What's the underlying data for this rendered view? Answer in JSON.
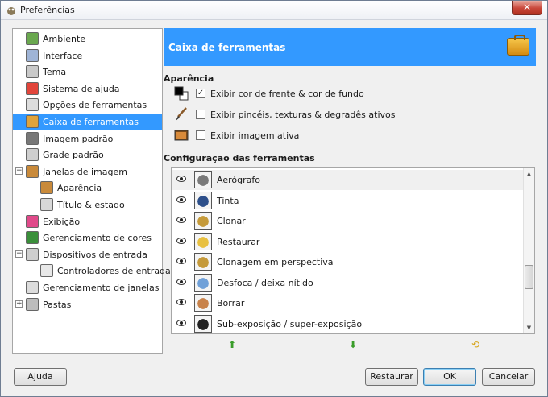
{
  "window": {
    "title": "Preferências",
    "close_glyph": "✕"
  },
  "sidebar": {
    "items": [
      {
        "label": "Ambiente",
        "icon": "environment-icon",
        "color": "#6aa84f",
        "level": 0,
        "expander": ""
      },
      {
        "label": "Interface",
        "icon": "interface-icon",
        "color": "#9fb4d6",
        "level": 0,
        "expander": ""
      },
      {
        "label": "Tema",
        "icon": "theme-icon",
        "color": "#c9c9c9",
        "level": 0,
        "expander": ""
      },
      {
        "label": "Sistema de ajuda",
        "icon": "lifebuoy-icon",
        "color": "#e2453b",
        "level": 0,
        "expander": ""
      },
      {
        "label": "Opções de ferramentas",
        "icon": "tool-options-icon",
        "color": "#dddddd",
        "level": 0,
        "expander": ""
      },
      {
        "label": "Caixa de ferramentas",
        "icon": "toolbox-icon",
        "color": "#e0a33a",
        "level": 0,
        "expander": "",
        "selected": true
      },
      {
        "label": "Imagem padrão",
        "icon": "default-image-icon",
        "color": "#777777",
        "level": 0,
        "expander": ""
      },
      {
        "label": "Grade padrão",
        "icon": "grid-icon",
        "color": "#cfcfcf",
        "level": 0,
        "expander": ""
      },
      {
        "label": "Janelas de imagem",
        "icon": "image-windows-icon",
        "color": "#c98a3a",
        "level": 0,
        "expander": "−"
      },
      {
        "label": "Aparência",
        "icon": "appearance-icon",
        "color": "#c98a3a",
        "level": 1,
        "expander": ""
      },
      {
        "label": "Título & estado",
        "icon": "title-status-icon",
        "color": "#d8d8d8",
        "level": 1,
        "expander": ""
      },
      {
        "label": "Exibição",
        "icon": "display-icon",
        "color": "#e04a8a",
        "level": 0,
        "expander": ""
      },
      {
        "label": "Gerenciamento de cores",
        "icon": "color-management-icon",
        "color": "#3a8f3a",
        "level": 0,
        "expander": ""
      },
      {
        "label": "Dispositivos de entrada",
        "icon": "input-devices-icon",
        "color": "#cfcfcf",
        "level": 0,
        "expander": "−"
      },
      {
        "label": "Controladores de entrada",
        "icon": "input-controllers-icon",
        "color": "#e8e8e8",
        "level": 1,
        "expander": ""
      },
      {
        "label": "Gerenciamento de janelas",
        "icon": "window-management-icon",
        "color": "#dcdcdc",
        "level": 0,
        "expander": ""
      },
      {
        "label": "Pastas",
        "icon": "folders-icon",
        "color": "#bdbdbd",
        "level": 0,
        "expander": "+"
      }
    ]
  },
  "banner": {
    "title": "Caixa de ferramentas",
    "icon": "toolbox-icon"
  },
  "appearance": {
    "heading": "Aparência",
    "options": [
      {
        "label": "Exibir cor de frente &  cor de fundo",
        "checked": true,
        "check_glyph": "✓",
        "icon": "fg-bg-color-icon"
      },
      {
        "label": "Exibir pincéis, texturas & degradês ativos",
        "checked": false,
        "check_glyph": "",
        "icon": "brush-icon"
      },
      {
        "label": "Exibir imagem ativa",
        "checked": false,
        "check_glyph": "",
        "icon": "active-image-icon"
      }
    ]
  },
  "tools": {
    "heading": "Configuração das ferramentas",
    "items": [
      {
        "label": "Aerógrafo",
        "icon": "airbrush-icon",
        "color": "#7a7a7a"
      },
      {
        "label": "Tinta",
        "icon": "ink-icon",
        "color": "#2d4f8a"
      },
      {
        "label": "Clonar",
        "icon": "clone-icon",
        "color": "#c59a3a"
      },
      {
        "label": "Restaurar",
        "icon": "heal-icon",
        "color": "#e8c040"
      },
      {
        "label": "Clonagem em perspectiva",
        "icon": "perspective-clone-icon",
        "color": "#c59a3a"
      },
      {
        "label": "Desfoca / deixa nítido",
        "icon": "blur-sharpen-icon",
        "color": "#6fa0d8"
      },
      {
        "label": "Borrar",
        "icon": "smudge-icon",
        "color": "#c8824a"
      },
      {
        "label": "Sub-exposição / super-exposição",
        "icon": "dodge-burn-icon",
        "color": "#222222"
      }
    ],
    "scroll_up_glyph": "▲",
    "scroll_down_glyph": "▼",
    "move_up_glyph": "⬆",
    "move_down_glyph": "⬇",
    "reset_glyph": "⟲"
  },
  "buttons": {
    "help": "Ajuda",
    "reset": "Restaurar",
    "ok": "OK",
    "cancel": "Cancelar"
  },
  "colors": {
    "selection": "#3399ff",
    "arrow_green": "#3a9d2a",
    "reset_yellow": "#d6a214"
  }
}
